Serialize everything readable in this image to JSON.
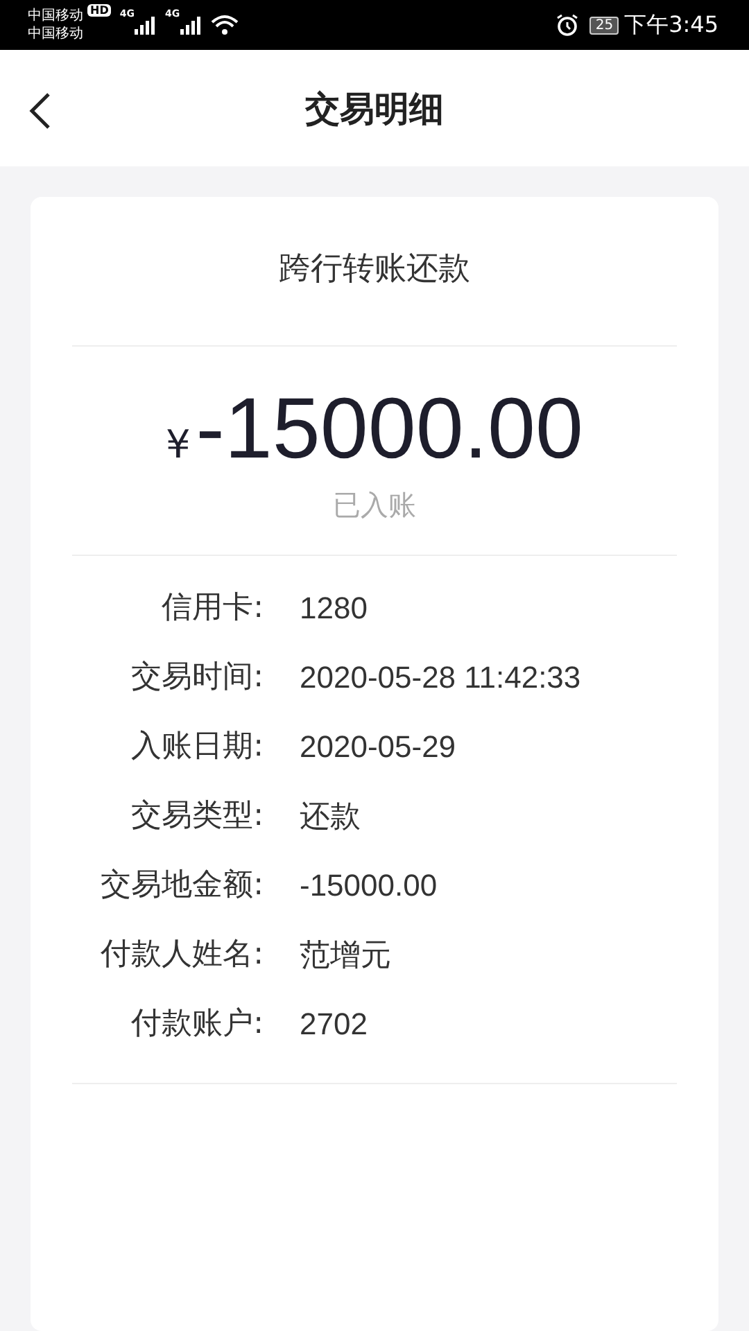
{
  "status_bar": {
    "carriers": [
      "中国移动",
      "中国移动"
    ],
    "hd_badge": "HD",
    "networks": [
      "4G",
      "4G"
    ],
    "battery": "25",
    "time": "下午3:45"
  },
  "header": {
    "title": "交易明细"
  },
  "transaction": {
    "title": "跨行转账还款",
    "currency": "¥",
    "amount": "-15000.00",
    "status": "已入账"
  },
  "details": [
    {
      "label": "信用卡:",
      "value": "1280"
    },
    {
      "label": "交易时间:",
      "value": "2020-05-28 11:42:33"
    },
    {
      "label": "入账日期:",
      "value": "2020-05-29"
    },
    {
      "label": "交易类型:",
      "value": "还款"
    },
    {
      "label": "交易地金额:",
      "value": "-15000.00"
    },
    {
      "label": "付款人姓名:",
      "value": "范增元"
    },
    {
      "label": "付款账户:",
      "value": "2702"
    }
  ]
}
